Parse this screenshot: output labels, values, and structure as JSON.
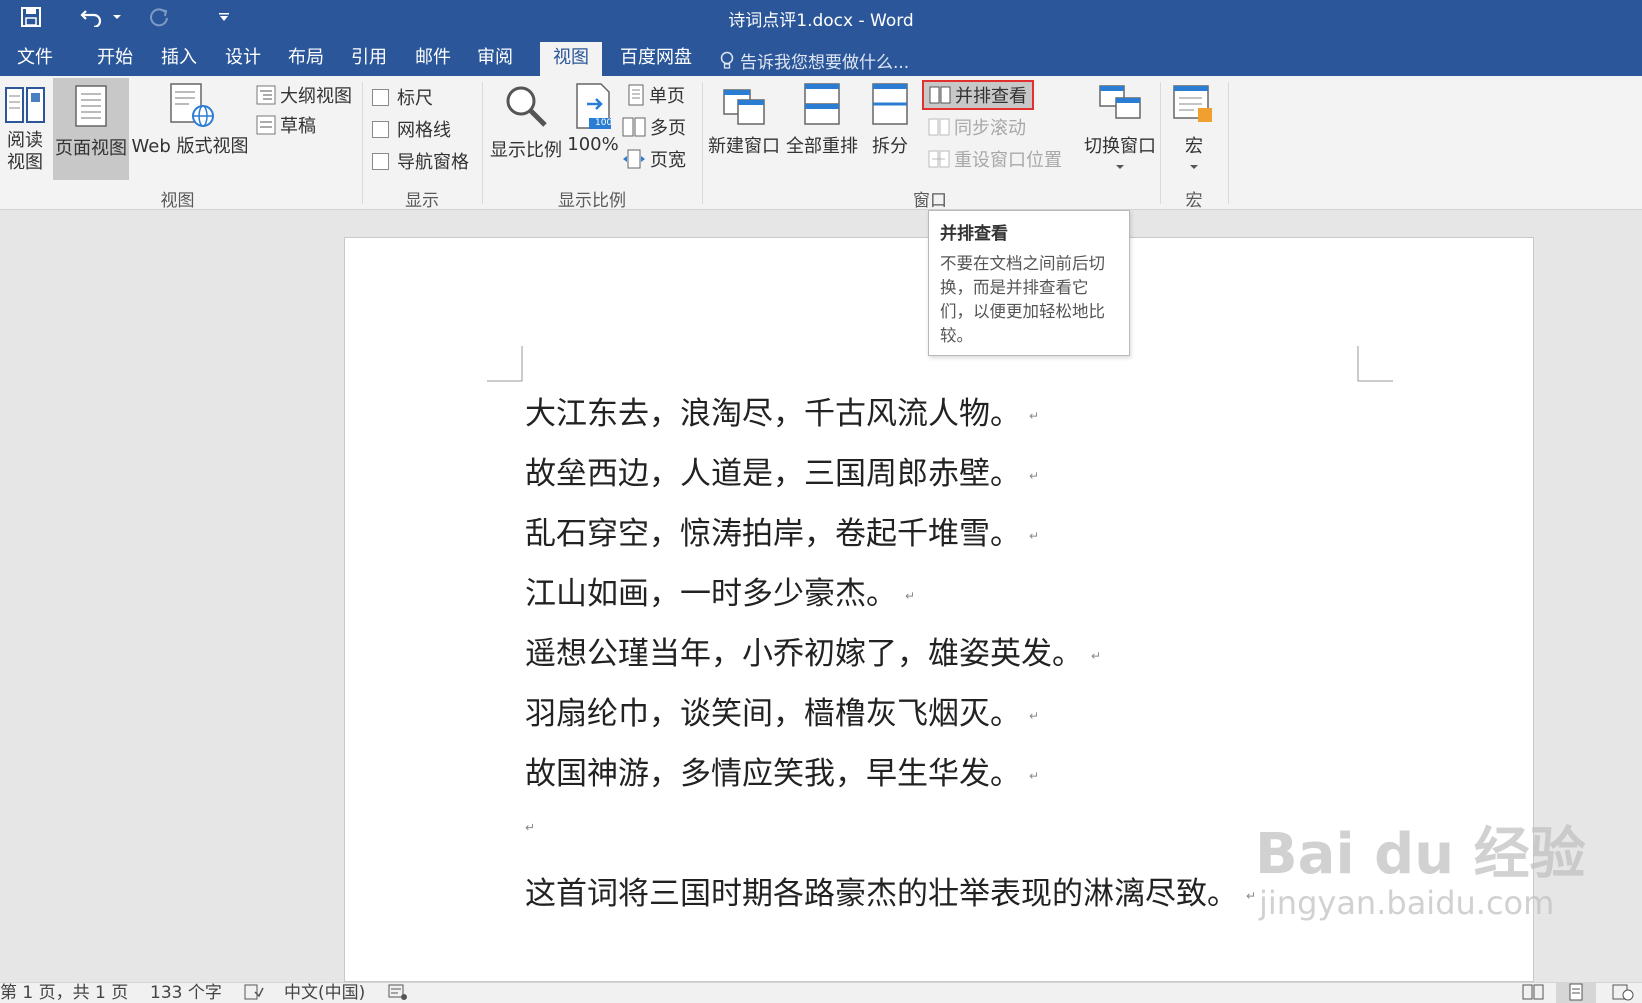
{
  "window": {
    "title": "诗词点评1.docx - Word",
    "accent_color": "#2b579a"
  },
  "quick_access": {
    "save_icon": "save-icon",
    "undo_icon": "undo-icon",
    "redo_icon": "redo-icon",
    "customize_icon": "customize-qat-icon"
  },
  "tabs": [
    {
      "label": "文件"
    },
    {
      "label": "开始"
    },
    {
      "label": "插入"
    },
    {
      "label": "设计"
    },
    {
      "label": "布局"
    },
    {
      "label": "引用"
    },
    {
      "label": "邮件"
    },
    {
      "label": "审阅"
    },
    {
      "label": "视图",
      "active": true
    },
    {
      "label": "百度网盘"
    }
  ],
  "tell_me": {
    "placeholder": "告诉我您想要做什么..."
  },
  "ribbon": {
    "views": {
      "group_label": "视图",
      "read_mode": "阅读\n视图",
      "read_mode_line1": "阅读",
      "read_mode_line2": "视图",
      "print_layout": "页面视图",
      "web_layout": "Web 版式视图",
      "outline": "大纲视图",
      "draft": "草稿"
    },
    "show": {
      "group_label": "显示",
      "ruler": "标尺",
      "gridlines": "网格线",
      "nav_pane": "导航窗格"
    },
    "zoom": {
      "group_label": "显示比例",
      "zoom": "显示比例",
      "hundred": "100%",
      "hundred_badge": "100",
      "one_page": "单页",
      "multi_page": "多页",
      "page_width": "页宽"
    },
    "window": {
      "group_label": "窗口",
      "new_window": "新建窗口",
      "arrange_all": "全部重排",
      "split": "拆分",
      "side_by_side": "并排查看",
      "sync_scroll": "同步滚动",
      "reset_position": "重设窗口位置",
      "switch_windows": "切换窗口"
    },
    "macros": {
      "group_label": "宏",
      "macros": "宏"
    }
  },
  "tooltip": {
    "title": "并排查看",
    "body": "不要在文档之间前后切换，而是并排查看它们，以便更加轻松地比较。"
  },
  "document": {
    "lines": [
      "大江东去，浪淘尽，千古风流人物。",
      "故垒西边，人道是，三国周郎赤壁。",
      "乱石穿空，惊涛拍岸，卷起千堆雪。",
      "江山如画，一时多少豪杰。",
      "遥想公瑾当年，小乔初嫁了，雄姿英发。",
      "羽扇纶巾，谈笑间，樯橹灰飞烟灭。",
      "故国神游，多情应笑我，早生华发。",
      "",
      "这首词将三国时期各路豪杰的壮举表现的淋漓尽致。"
    ],
    "paragraph_mark": "↵"
  },
  "watermark": {
    "logo": "Bai du 经验",
    "url": "jingyan.baidu.com"
  },
  "status_bar": {
    "page_info": "第 1 页，共 1 页",
    "word_count": "133 个字",
    "language": "中文(中国)"
  }
}
